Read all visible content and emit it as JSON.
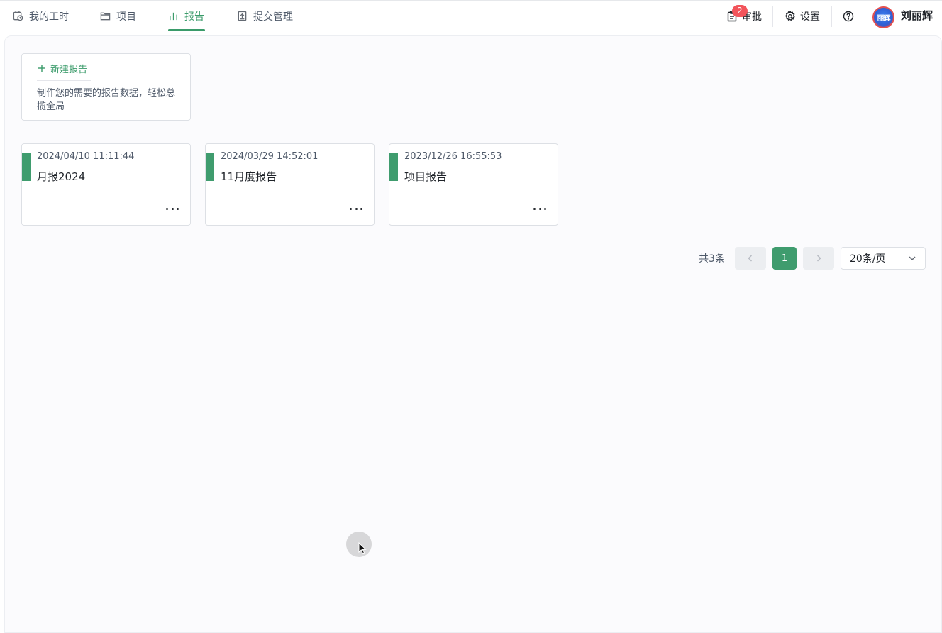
{
  "nav": {
    "tabs": [
      {
        "label": "我的工时",
        "icon": "clock-calendar-icon"
      },
      {
        "label": "项目",
        "icon": "folder-icon"
      },
      {
        "label": "报告",
        "icon": "bar-chart-icon",
        "active": true
      },
      {
        "label": "提交管理",
        "icon": "upload-doc-icon"
      }
    ],
    "approval": {
      "label": "审批",
      "badge": "2"
    },
    "settings": {
      "label": "设置"
    },
    "user": {
      "name": "刘丽辉",
      "avatar_text": "丽辉"
    }
  },
  "new_report": {
    "label": "新建报告",
    "description": "制作您的需要的报告数据，轻松总揽全局"
  },
  "reports": [
    {
      "date": "2024/04/10 11:11:44",
      "title": "月报2024"
    },
    {
      "date": "2024/03/29 14:52:01",
      "title": "11月度报告"
    },
    {
      "date": "2023/12/26 16:55:53",
      "title": "项目报告"
    }
  ],
  "pagination": {
    "total": "共3条",
    "current_page": "1",
    "page_size": "20条/页"
  },
  "colors": {
    "accent": "#3a9b6a",
    "badge": "#f2545b"
  }
}
